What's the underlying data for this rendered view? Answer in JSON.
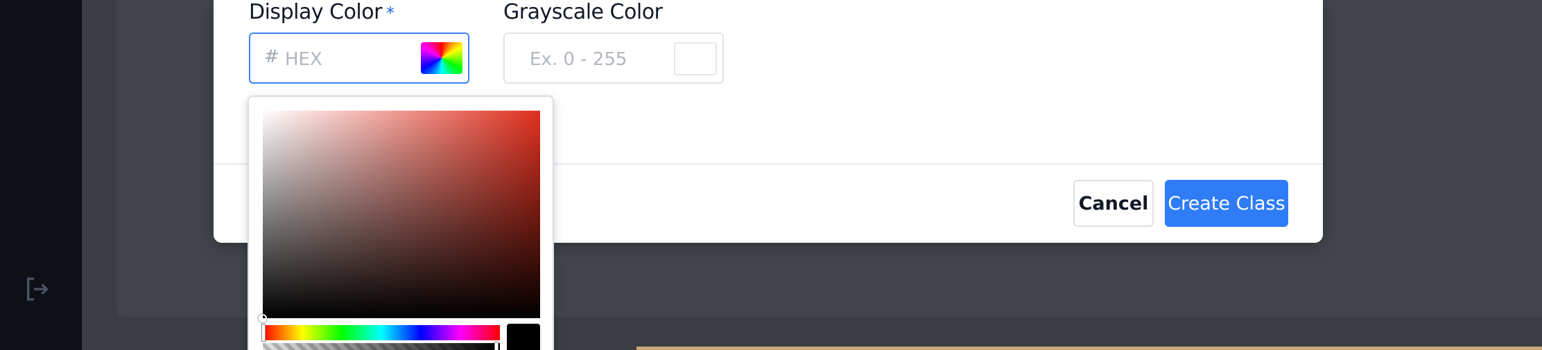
{
  "sidebar": {
    "logout_icon": "logout-icon"
  },
  "form": {
    "display_color": {
      "label": "Display Color",
      "required_mark": "*",
      "hash": "#",
      "placeholder": "HEX",
      "picker_icon": "color-wheel-icon"
    },
    "grayscale_color": {
      "label": "Grayscale Color",
      "placeholder": "Ex. 0 - 255"
    }
  },
  "footer": {
    "cancel_label": "Cancel",
    "create_label": "Create Class"
  },
  "colors": {
    "accent": "#2f7cf6",
    "focus_border": "#3b82f6",
    "required": "#2563eb",
    "picker_preview": "#000000",
    "picker_hue": "#e0301e"
  }
}
